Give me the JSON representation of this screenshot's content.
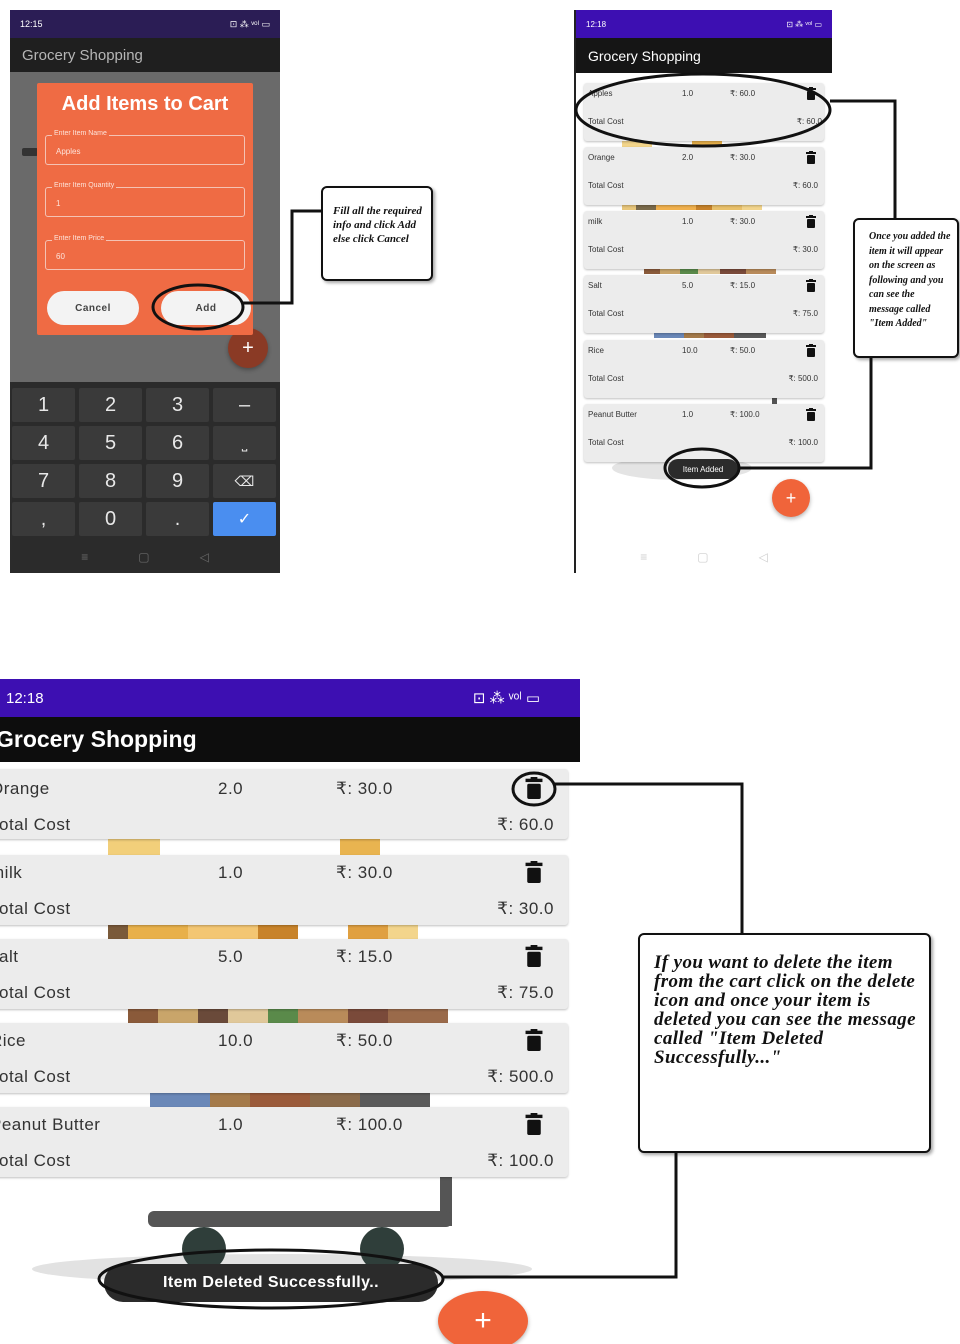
{
  "app": {
    "title": "Grocery Shopping"
  },
  "phone1": {
    "status_time": "12:15",
    "status_right": "⊡ ⁂ ᵛᵒˡ ▭",
    "dialog": {
      "title": "Add Items to Cart",
      "fields": [
        {
          "label": "Enter Item Name",
          "value": "Apples"
        },
        {
          "label": "Enter Item Quantity",
          "value": "1"
        },
        {
          "label": "Enter Item Price",
          "value": "60"
        }
      ],
      "cancel_label": "Cancel",
      "add_label": "Add"
    },
    "keypad": [
      "1",
      "2",
      "3",
      "–",
      "4",
      "5",
      "6",
      "⎵",
      "7",
      "8",
      "9",
      "⌫",
      ",",
      "0",
      ".",
      "✓"
    ]
  },
  "phone2": {
    "status_time": "12:18",
    "status_right": "⊡ ⁂ ᵛᵒˡ ▭",
    "items": [
      {
        "name": "Apples",
        "qty": "1.0",
        "price": "₹: 60.0",
        "total_label": "Total Cost",
        "total": "₹: 60.0"
      },
      {
        "name": "Orange",
        "qty": "2.0",
        "price": "₹: 30.0",
        "total_label": "Total Cost",
        "total": "₹: 60.0"
      },
      {
        "name": "milk",
        "qty": "1.0",
        "price": "₹: 30.0",
        "total_label": "Total Cost",
        "total": "₹: 30.0"
      },
      {
        "name": "Salt",
        "qty": "5.0",
        "price": "₹: 15.0",
        "total_label": "Total Cost",
        "total": "₹: 75.0"
      },
      {
        "name": "Rice",
        "qty": "10.0",
        "price": "₹: 50.0",
        "total_label": "Total Cost",
        "total": "₹: 500.0"
      },
      {
        "name": "Peanut Butter",
        "qty": "1.0",
        "price": "₹: 100.0",
        "total_label": "Total Cost",
        "total": "₹: 100.0"
      }
    ],
    "toast": "Item Added",
    "fab_label": "+"
  },
  "phone3": {
    "status_time": "12:18",
    "status_right": "⊡ ⁂ ᵛᵒˡ ▭",
    "items": [
      {
        "name": "Orange",
        "qty": "2.0",
        "price": "₹: 30.0",
        "total_label": "Total Cost",
        "total": "₹: 60.0"
      },
      {
        "name": "milk",
        "qty": "1.0",
        "price": "₹: 30.0",
        "total_label": "Total Cost",
        "total": "₹: 30.0"
      },
      {
        "name": "salt",
        "qty": "5.0",
        "price": "₹: 15.0",
        "total_label": "Total Cost",
        "total": "₹: 75.0"
      },
      {
        "name": "Rice",
        "qty": "10.0",
        "price": "₹: 50.0",
        "total_label": "Total Cost",
        "total": "₹: 500.0"
      },
      {
        "name": "Peanut Butter",
        "qty": "1.0",
        "price": "₹: 100.0",
        "total_label": "Total Cost",
        "total": "₹: 100.0"
      }
    ],
    "toast": "Item Deleted Successfully..",
    "fab_label": "+"
  },
  "callouts": {
    "fill_info": "Fill all the required info and click Add else click Cancel",
    "item_added": "Once you added the item it will appear on the screen as following and you can see the message called \"Item Added\"",
    "item_deleted": "If you want to delete the item from the cart click on the delete icon and once your item is deleted you can see the message called \"Item Deleted Successfully...\""
  },
  "colors": {
    "status_bar": "#3d0fb2",
    "app_bar": "#121212",
    "accent": "#f0643a",
    "card": "#ececec"
  },
  "icons": [
    "trash-icon",
    "plus-icon",
    "check-icon",
    "backspace-icon",
    "space-icon"
  ]
}
